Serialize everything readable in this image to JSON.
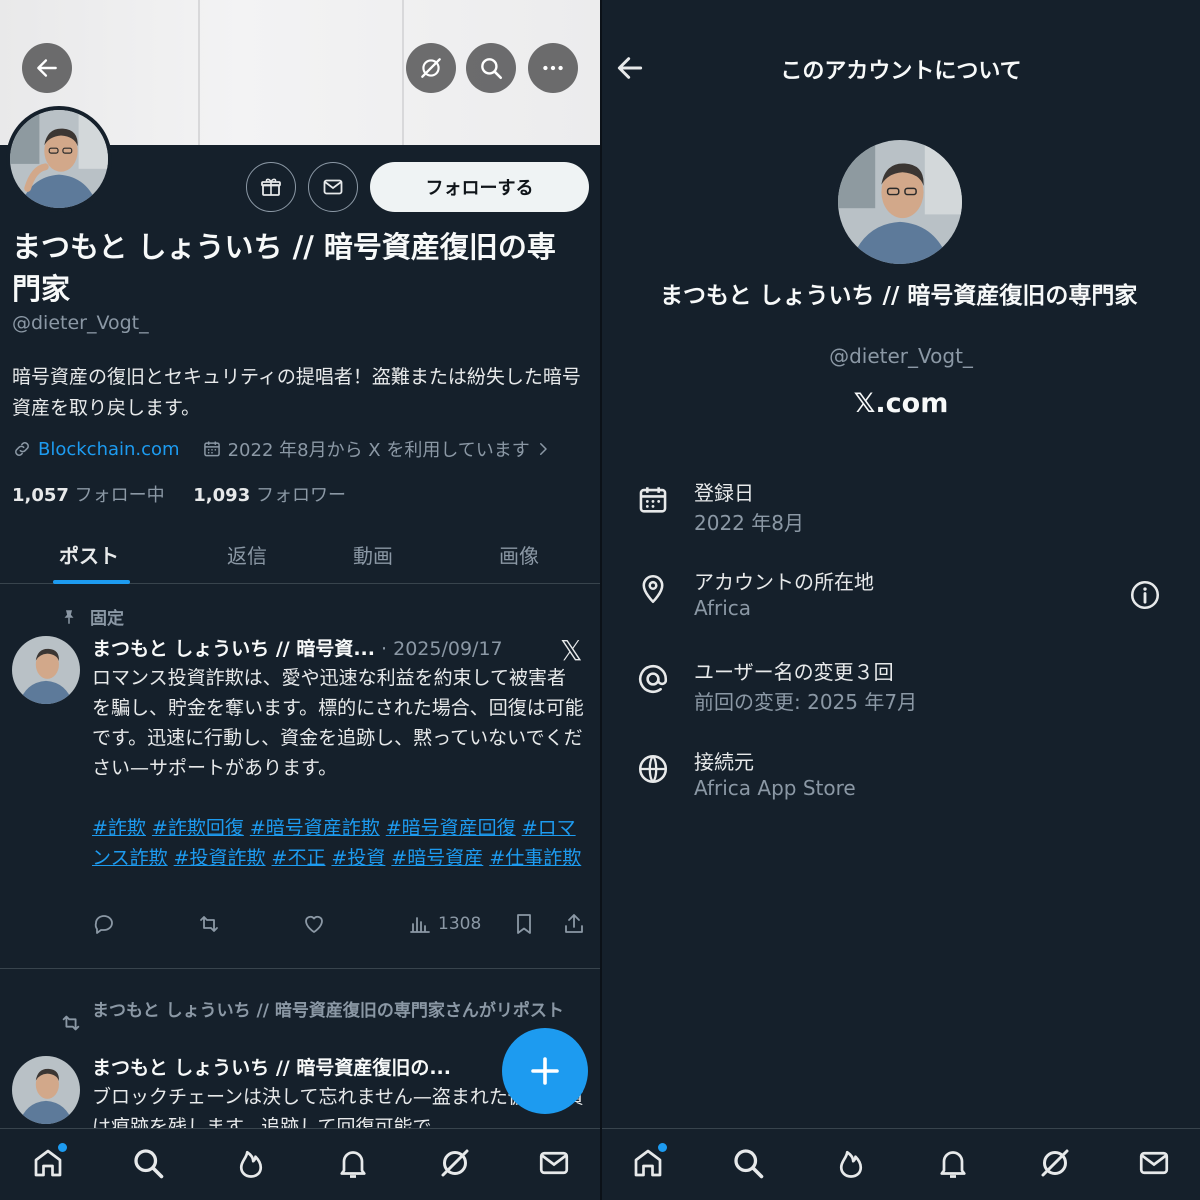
{
  "profile": {
    "name": "まつもと しょういち // 暗号資産復旧の専門家",
    "handle": "@dieter_Vogt_",
    "bio": "暗号資産の復旧とセキュリティの提唱者！盗難または紛失した暗号資産を取り戻します。",
    "website": "Blockchain.com",
    "joined": "2022 年8月から X を利用しています",
    "following_count": "1,057",
    "following_label": "フォロー中",
    "followers_count": "1,093",
    "followers_label": "フォロワー",
    "follow_button": "フォローする"
  },
  "tabs": [
    {
      "label": "ポスト"
    },
    {
      "label": "返信"
    },
    {
      "label": "動画"
    },
    {
      "label": "画像"
    }
  ],
  "posts": [
    {
      "pinned_label": "固定",
      "author": "まつもと しょういち // 暗号資...",
      "date": "· 2025/09/17",
      "x_mark": "𝕏",
      "text": "ロマンス投資詐欺は、愛や迅速な利益を約束して被害者を騙し、貯金を奪います。標的にされた場合、回復は可能です。迅速に行動し、資金を追跡し、黙っていないでください—サポートがあります。",
      "hashtags": [
        "#詐欺",
        "#詐欺回復",
        "#暗号資産詐欺",
        "#暗号資産回復",
        "#ロマンス詐欺",
        "#投資詐欺",
        "#不正",
        "#投資",
        "#暗号資産",
        "#仕事詐欺"
      ],
      "views": "1308"
    },
    {
      "repost_label": "まつもと しょういち // 暗号資産復旧の専門家さんがリポスト",
      "author": "まつもと しょういち // 暗号資産復旧の...",
      "text": "ブロックチェーンは決して忘れません—盗まれた仮想通貨は痕跡を残します。追跡して回復可能で"
    }
  ],
  "about": {
    "title": "このアカウントについて",
    "name": "まつもと しょういち // 暗号資産復旧の専門家",
    "handle": "@dieter_Vogt_",
    "domain": "𝕏.com",
    "rows": [
      {
        "label": "登録日",
        "value": "2022 年8月",
        "icon": "calendar-icon"
      },
      {
        "label": "アカウントの所在地",
        "value": "Africa",
        "icon": "location-pin-icon"
      },
      {
        "label": "ユーザー名の変更３回",
        "value": "前回の変更: 2025 年7月",
        "icon": "at-sign-icon"
      },
      {
        "label": "接続元",
        "value": "Africa App Store",
        "icon": "globe-icon"
      }
    ]
  },
  "colors": {
    "accent": "#1d9bf0",
    "background": "#15202b",
    "muted": "#8b98a5"
  }
}
